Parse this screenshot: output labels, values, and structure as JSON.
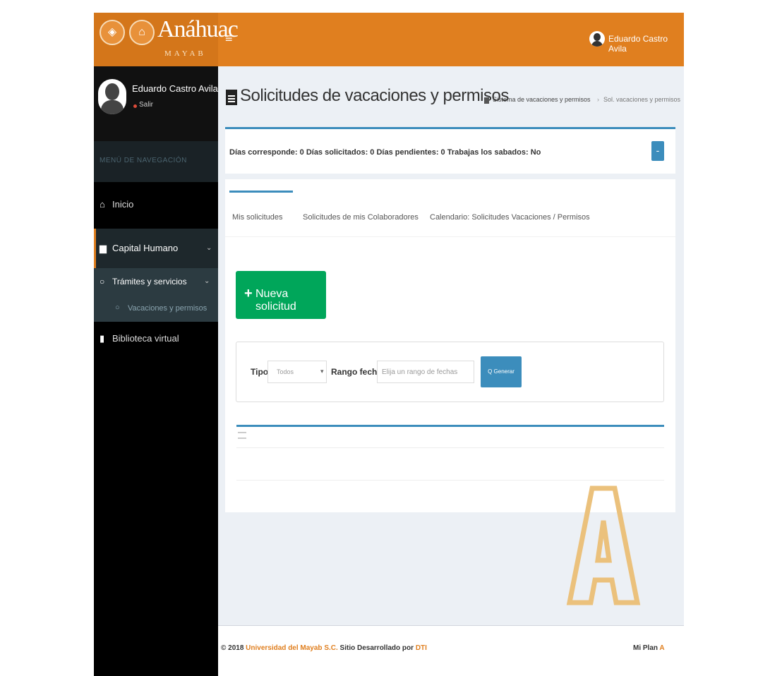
{
  "header": {
    "brand_name": "Anáhuac",
    "brand_sub": "MAYAB",
    "menu_icon": "≡",
    "user_name": "Eduardo Castro Avila"
  },
  "sidebar": {
    "user_name": "Eduardo Castro Avila",
    "logout": "Salir",
    "nav_header": "MENÚ DE NAVEGACIÓN",
    "items": [
      {
        "label": "Inicio",
        "icon": "home-icon"
      },
      {
        "label": "Capital Humano",
        "icon": "briefcase-icon"
      },
      {
        "label": "Trámites y servicios",
        "icon": "circle-icon"
      },
      {
        "label": "Vacaciones y permisos",
        "icon": "circle-icon"
      },
      {
        "label": "Biblioteca virtual",
        "icon": "book-icon"
      }
    ]
  },
  "content": {
    "title": "Solicitudes de vacaciones y permisos",
    "breadcrumb": {
      "home": "Sistema de vacaciones y permisos",
      "current": "Sol. vacaciones y permisos"
    },
    "summary": "Días corresponde: 0  Días solicitados: 0  Días pendientes: 0  Trabajas los sabados: No",
    "collapse_label": "-",
    "tabs": [
      "Mis solicitudes",
      "Solicitudes de mis Colaboradores",
      "Calendario: Solicitudes Vacaciones / Permisos"
    ],
    "new_button": "Nueva solicitud",
    "filter": {
      "tipo_label": "Tipo",
      "tipo_value": "Todos",
      "range_label": "Rango fechas",
      "range_placeholder": "Elija un rango de fechas",
      "generate_label": "Q Generar"
    }
  },
  "footer": {
    "copyright": "© 2018 ",
    "org": "Universidad del Mayab S.C.",
    "developed": " Sitio Desarrollado por ",
    "dev": "DTI",
    "right_text": "Mi Plan ",
    "right_accent": "A"
  },
  "colors": {
    "brand_orange": "#e07f1f",
    "primary_blue": "#3c8dbc",
    "success_green": "#00a65a"
  }
}
